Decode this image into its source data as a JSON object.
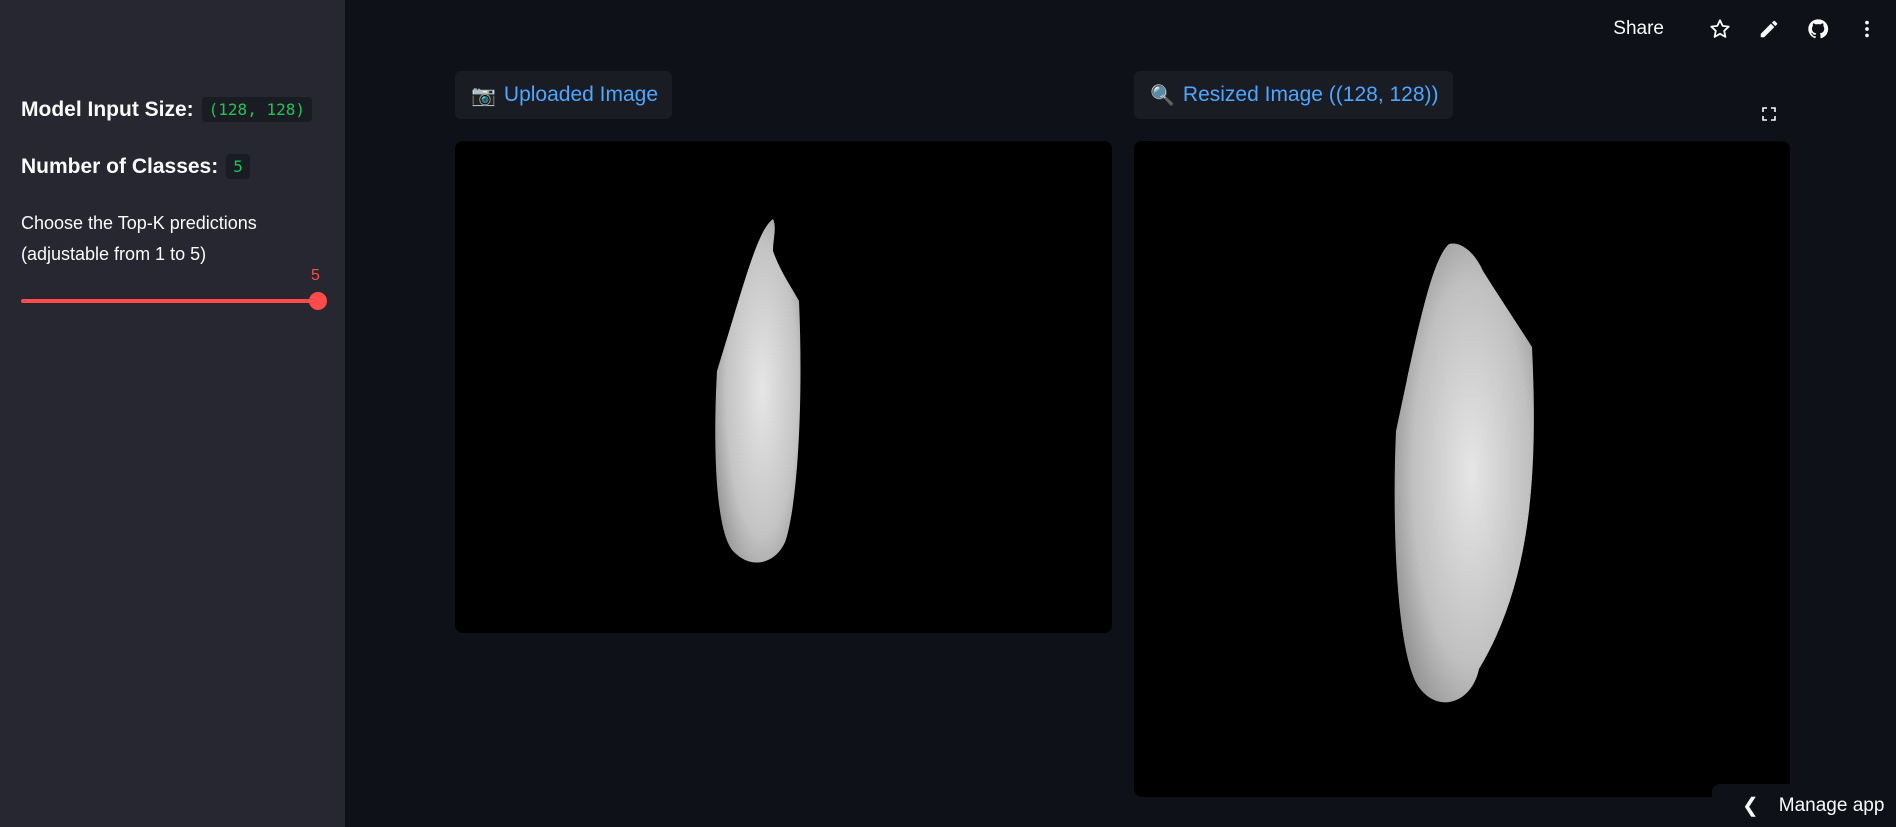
{
  "sidebar": {
    "model_input_label": "Model Input Size:",
    "model_input_value": "(128, 128)",
    "num_classes_label": "Number of Classes:",
    "num_classes_value": "5",
    "topk_description_line1": "Choose the Top-K predictions",
    "topk_description_line2": "(adjustable from 1 to 5)",
    "slider": {
      "value": "5",
      "min": 1,
      "max": 5
    }
  },
  "toolbar": {
    "share_label": "Share",
    "icons": [
      "star-icon",
      "pencil-icon",
      "github-icon",
      "more-vertical-icon"
    ]
  },
  "main": {
    "uploaded_caption": "Uploaded Image",
    "uploaded_emoji": "📷",
    "resized_caption": "Resized Image ((128, 128))",
    "resized_emoji": "🔍"
  },
  "footer": {
    "manage_label": "Manage app"
  },
  "colors": {
    "accent": "#ff4b4b",
    "link": "#4da6ff",
    "code": "#21c354",
    "sidebar_bg": "#262730",
    "main_bg": "#0e1117"
  }
}
